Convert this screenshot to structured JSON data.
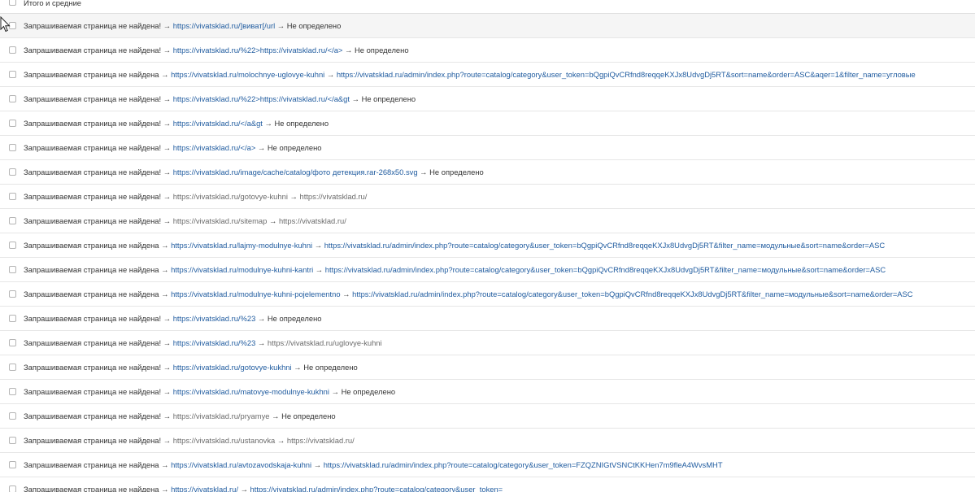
{
  "total_row": {
    "label": "Итого и средние"
  },
  "rows": [
    {
      "prefix": "Запрашиваемая страница не найдена! →",
      "from": "https://vivatsklad.ru/]виват[/url",
      "from_style": "link",
      "arrow": "→",
      "to": "Не определено",
      "to_style": "plain"
    },
    {
      "prefix": "Запрашиваемая страница не найдена! →",
      "from": "https://vivatsklad.ru/%22>https://vivatsklad.ru/</a>",
      "from_style": "link",
      "arrow": "→",
      "to": "Не определено",
      "to_style": "plain"
    },
    {
      "prefix": "Запрашиваемая страница не найдена →",
      "from": "https://vivatsklad.ru/molochnye-uglovye-kuhni",
      "from_style": "link",
      "arrow": "→",
      "to": "https://vivatsklad.ru/admin/index.php?route=catalog/category&user_token=bQgpiQvCRfnd8reqqeKXJx8UdvgDj5RT&sort=name&order=ASC&aqer=1&filter_name=угловые",
      "to_style": "link"
    },
    {
      "prefix": "Запрашиваемая страница не найдена! →",
      "from": "https://vivatsklad.ru/%22>https://vivatsklad.ru/</a&gt",
      "from_style": "link",
      "arrow": "→",
      "to": "Не определено",
      "to_style": "plain"
    },
    {
      "prefix": "Запрашиваемая страница не найдена! →",
      "from": "https://vivatsklad.ru/</a&gt",
      "from_style": "link",
      "arrow": "→",
      "to": "Не определено",
      "to_style": "plain"
    },
    {
      "prefix": "Запрашиваемая страница не найдена! →",
      "from": "https://vivatsklad.ru/</a>",
      "from_style": "link",
      "arrow": "→",
      "to": "Не определено",
      "to_style": "plain"
    },
    {
      "prefix": "Запрашиваемая страница не найдена! →",
      "from": "https://vivatsklad.ru/image/cache/catalog/фото детекция.rar-268x50.svg",
      "from_style": "link",
      "arrow": "→",
      "to": "Не определено",
      "to_style": "plain"
    },
    {
      "prefix": "Запрашиваемая страница не найдена! →",
      "from": "https://vivatsklad.ru/gotovye-kuhni",
      "from_style": "muted",
      "arrow": "→",
      "to": "https://vivatsklad.ru/",
      "to_style": "muted"
    },
    {
      "prefix": "Запрашиваемая страница не найдена! →",
      "from": "https://vivatsklad.ru/sitemap",
      "from_style": "muted",
      "arrow": "→",
      "to": "https://vivatsklad.ru/",
      "to_style": "muted"
    },
    {
      "prefix": "Запрашиваемая страница не найдена →",
      "from": "https://vivatsklad.ru/lajmy-modulnye-kuhni",
      "from_style": "link",
      "arrow": "→",
      "to": "https://vivatsklad.ru/admin/index.php?route=catalog/category&user_token=bQgpiQvCRfnd8reqqeKXJx8UdvgDj5RT&filter_name=модульные&sort=name&order=ASC",
      "to_style": "link"
    },
    {
      "prefix": "Запрашиваемая страница не найдена →",
      "from": "https://vivatsklad.ru/modulnye-kuhni-kantri",
      "from_style": "link",
      "arrow": "→",
      "to": "https://vivatsklad.ru/admin/index.php?route=catalog/category&user_token=bQgpiQvCRfnd8reqqeKXJx8UdvgDj5RT&filter_name=модульные&sort=name&order=ASC",
      "to_style": "link"
    },
    {
      "prefix": "Запрашиваемая страница не найдена →",
      "from": "https://vivatsklad.ru/modulnye-kuhni-pojelementno",
      "from_style": "link",
      "arrow": "→",
      "to": "https://vivatsklad.ru/admin/index.php?route=catalog/category&user_token=bQgpiQvCRfnd8reqqeKXJx8UdvgDj5RT&filter_name=модульные&sort=name&order=ASC",
      "to_style": "link"
    },
    {
      "prefix": "Запрашиваемая страница не найдена! →",
      "from": "https://vivatsklad.ru/%23",
      "from_style": "link",
      "arrow": "→",
      "to": "Не определено",
      "to_style": "plain"
    },
    {
      "prefix": "Запрашиваемая страница не найдена! →",
      "from": "https://vivatsklad.ru/%23",
      "from_style": "link",
      "arrow": "→",
      "to": "https://vivatsklad.ru/uglovye-kuhni",
      "to_style": "muted"
    },
    {
      "prefix": "Запрашиваемая страница не найдена! →",
      "from": "https://vivatsklad.ru/gotovye-kukhni",
      "from_style": "link",
      "arrow": "→",
      "to": "Не определено",
      "to_style": "plain"
    },
    {
      "prefix": "Запрашиваемая страница не найдена! →",
      "from": "https://vivatsklad.ru/matovye-modulnye-kukhni",
      "from_style": "link",
      "arrow": "→",
      "to": "Не определено",
      "to_style": "plain"
    },
    {
      "prefix": "Запрашиваемая страница не найдена! →",
      "from": "https://vivatsklad.ru/pryamye",
      "from_style": "muted",
      "arrow": "→",
      "to": "Не определено",
      "to_style": "plain"
    },
    {
      "prefix": "Запрашиваемая страница не найдена! →",
      "from": "https://vivatsklad.ru/ustanovka",
      "from_style": "muted",
      "arrow": "→",
      "to": "https://vivatsklad.ru/",
      "to_style": "muted"
    },
    {
      "prefix": "Запрашиваемая страница не найдена →",
      "from": "https://vivatsklad.ru/avtozavodskaja-kuhni",
      "from_style": "link",
      "arrow": "→",
      "to": "https://vivatsklad.ru/admin/index.php?route=catalog/category&user_token=FZQZNIGtVSNCtKKHen7m9fleA4WvsMHT",
      "to_style": "link"
    },
    {
      "prefix": "Запрашиваемая страница не найдена →",
      "from": "https://vivatsklad.ru/",
      "from_style": "link",
      "arrow": "→",
      "to": "https://vivatsklad.ru/admin/index.php?route=catalog/category&user_token=",
      "to_style": "link"
    }
  ]
}
